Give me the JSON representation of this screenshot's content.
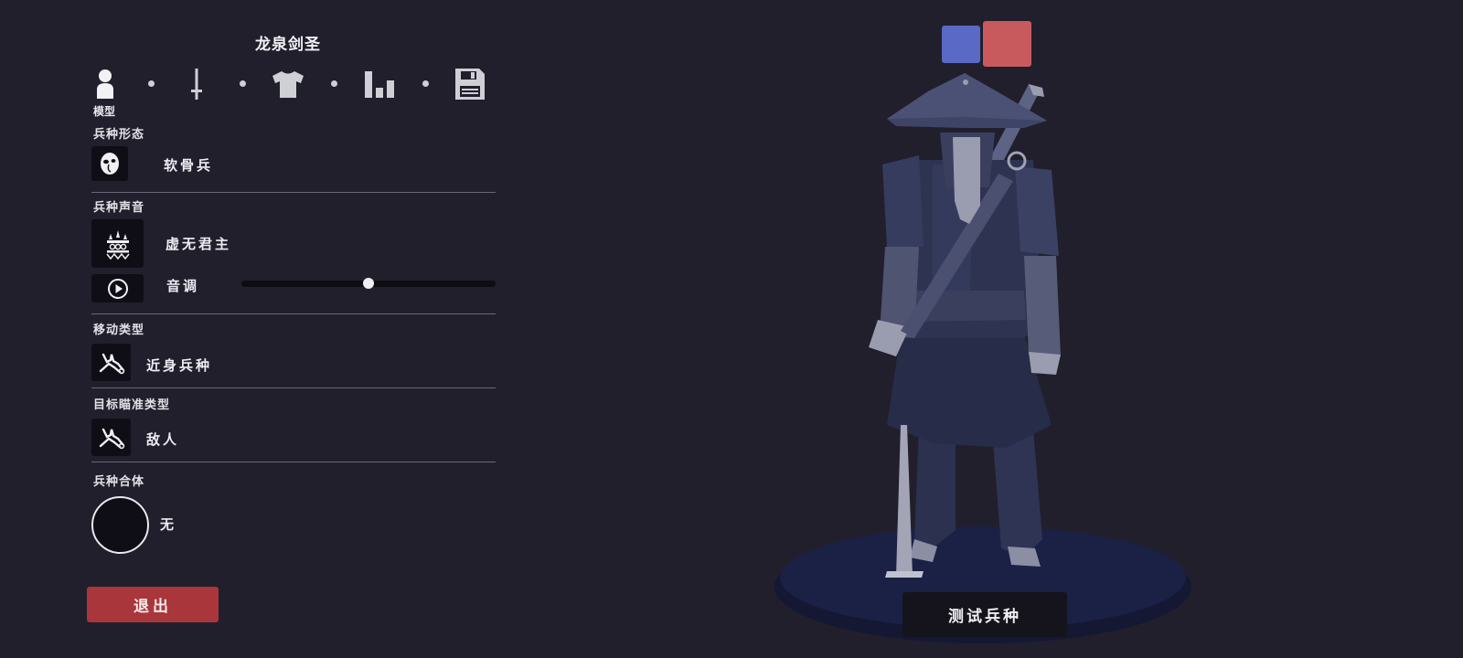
{
  "unit": {
    "name": "龙泉剑圣"
  },
  "steps": [
    {
      "label": "模型",
      "icon": "person-icon",
      "active": true
    },
    {
      "icon": "sword-icon"
    },
    {
      "icon": "shirt-icon"
    },
    {
      "icon": "stats-icon"
    },
    {
      "icon": "save-icon"
    }
  ],
  "sections": {
    "form": {
      "label": "兵种形态",
      "value": "软骨兵",
      "icon": "mask-icon"
    },
    "voice": {
      "label": "兵种声音",
      "value": "虚无君主",
      "icon": "voice-crown-icon"
    },
    "pitch": {
      "label": "音调",
      "level": 0.5,
      "icon": "play-icon"
    },
    "movement": {
      "label": "移动类型",
      "value": "近身兵种",
      "icon": "melee-unit-icon"
    },
    "targeting": {
      "label": "目标瞄准类型",
      "value": "敌人",
      "icon": "melee-unit-icon"
    },
    "fusion": {
      "label": "兵种合体",
      "value": "无"
    }
  },
  "buttons": {
    "exit": "退出",
    "test": "测试兵种"
  },
  "colors": {
    "background": "#211f2c",
    "swatch_blue": "#5a68c6",
    "swatch_red": "#c85a5e",
    "exit": "#a9363b",
    "figure_body": "#2e3352",
    "pedestal": "#161a36"
  }
}
